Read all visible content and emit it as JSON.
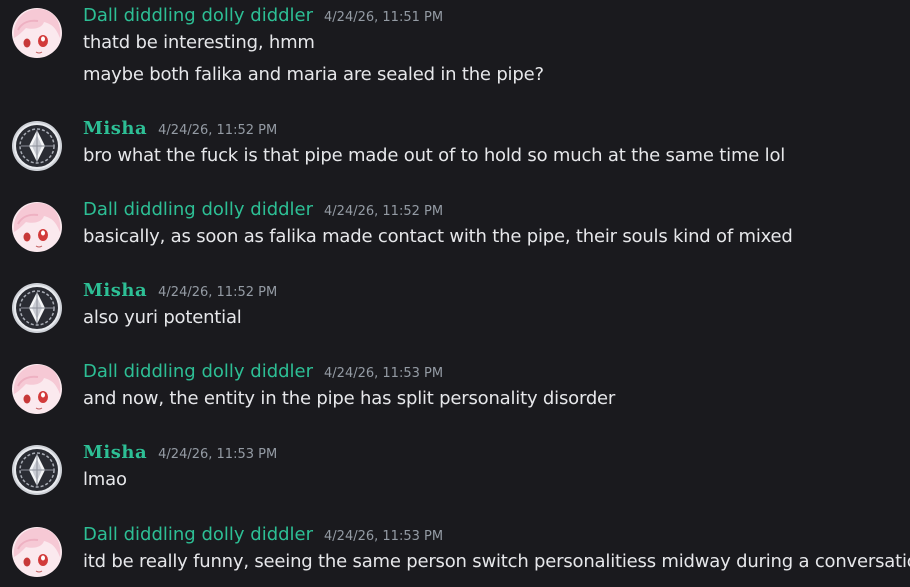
{
  "messages": [
    {
      "author": "Dall diddling dolly diddler",
      "avatar_icon": "anime-girl-avatar-icon",
      "time": "4/24/26, 11:51 PM",
      "lines": [
        "thatd be interesting, hmm",
        "maybe both falika and maria are sealed in the pipe?"
      ]
    },
    {
      "author": "Misha",
      "avatar_icon": "ornate-emblem-avatar-icon",
      "time": "4/24/26, 11:52 PM",
      "lines": [
        "bro what the fuck is that pipe made out of to hold so much at the same time lol"
      ]
    },
    {
      "author": "Dall diddling dolly diddler",
      "avatar_icon": "anime-girl-avatar-icon",
      "time": "4/24/26, 11:52 PM",
      "lines": [
        "basically, as soon as falika made contact with the pipe, their souls kind of mixed"
      ]
    },
    {
      "author": "Misha",
      "avatar_icon": "ornate-emblem-avatar-icon",
      "time": "4/24/26, 11:52 PM",
      "lines": [
        "also yuri potential"
      ]
    },
    {
      "author": "Dall diddling dolly diddler",
      "avatar_icon": "anime-girl-avatar-icon",
      "time": "4/24/26, 11:53 PM",
      "lines": [
        "and now, the entity in the pipe has split personality disorder"
      ]
    },
    {
      "author": "Misha",
      "avatar_icon": "ornate-emblem-avatar-icon",
      "time": "4/24/26, 11:53 PM",
      "lines": [
        "lmao"
      ]
    },
    {
      "author": "Dall diddling dolly diddler",
      "avatar_icon": "anime-girl-avatar-icon",
      "time": "4/24/26, 11:53 PM",
      "lines": [
        "itd be really funny, seeing the same person switch personalitiess midway during a conversation"
      ]
    }
  ],
  "colors": {
    "background": "#1a1a1e",
    "author_name": "#2dbf95",
    "timestamp": "#949ba4",
    "message_text": "#e6e7ea"
  }
}
